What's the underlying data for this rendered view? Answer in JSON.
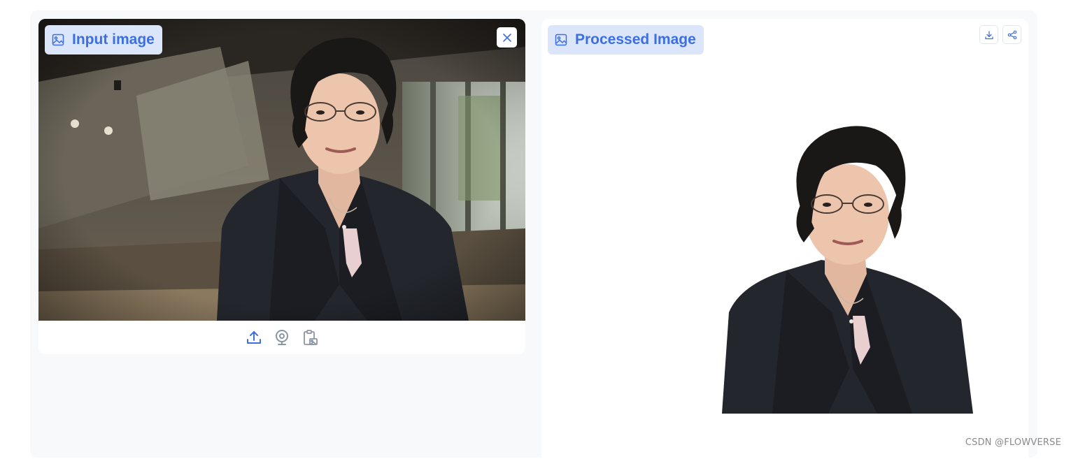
{
  "input_panel": {
    "label": "Input image",
    "label_icon": "image-icon",
    "close_icon": "close-icon",
    "source_buttons": [
      {
        "icon": "upload-icon"
      },
      {
        "icon": "webcam-icon"
      },
      {
        "icon": "clipboard-icon"
      }
    ]
  },
  "output_panel": {
    "label": "Processed Image",
    "label_icon": "image-icon",
    "download_icon": "download-icon",
    "share_icon": "share-icon"
  },
  "watermark": "CSDN @FLOWVERSE",
  "colors": {
    "accent": "#3d6fe3",
    "label_bg": "#dbe6fb",
    "panel_bg": "#f8f9fb"
  }
}
